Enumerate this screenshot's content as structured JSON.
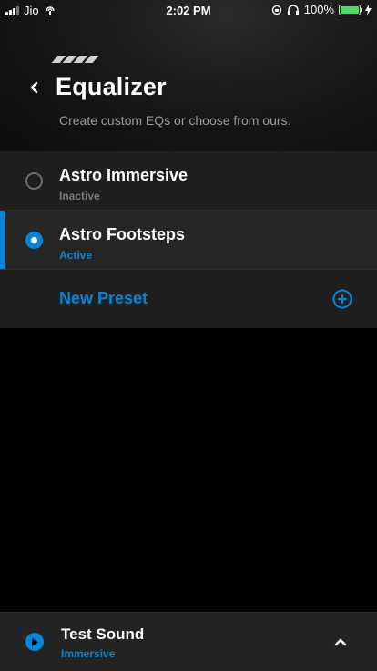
{
  "status_bar": {
    "carrier": "Jio",
    "time": "2:02 PM",
    "battery_percent": "100%",
    "battery_color": "#4cd964"
  },
  "header": {
    "title": "Equalizer",
    "subtitle": "Create custom EQs or choose from ours."
  },
  "presets": [
    {
      "name": "Astro Immersive",
      "status": "Inactive",
      "selected": false
    },
    {
      "name": "Astro Footsteps",
      "status": "Active",
      "selected": true
    }
  ],
  "new_preset": {
    "label": "New Preset"
  },
  "test_sound": {
    "title": "Test Sound",
    "subtitle": "Immersive"
  },
  "colors": {
    "accent": "#0a84d6",
    "background": "#000000",
    "row": "#1f1f1f"
  }
}
